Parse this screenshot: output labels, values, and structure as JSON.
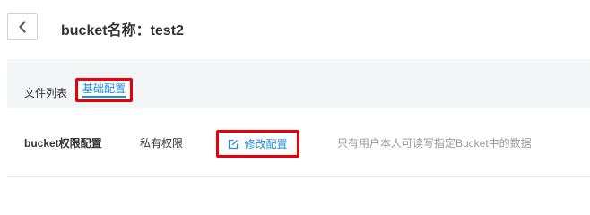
{
  "header": {
    "title": "bucket名称：test2",
    "back_icon": "chevron-left-icon"
  },
  "tabs": [
    {
      "label": "文件列表",
      "active": false
    },
    {
      "label": "基础配置",
      "active": true
    }
  ],
  "permission_row": {
    "label": "bucket权限配置",
    "value": "私有权限",
    "edit_button_label": "修改配置",
    "edit_icon": "edit-icon",
    "description": "只有用户本人可读写指定Bucket中的数据"
  },
  "colors": {
    "accent": "#1b8fe0",
    "highlight": "#e8000b",
    "tab_bar_bg": "#f4f5f6",
    "muted_text": "#999999"
  }
}
